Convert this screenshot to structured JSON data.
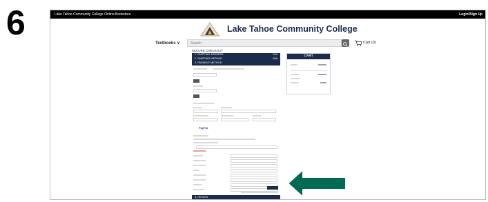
{
  "step_number": "6",
  "topbar": {
    "site_name": "Lake Tahoe Community College Online Bookstore",
    "login": "Login/Sign Up"
  },
  "brand": {
    "name": "Lake Tahoe Community College"
  },
  "nav": {
    "textbooks": "Textbooks ∨"
  },
  "search": {
    "placeholder": "Search"
  },
  "cart": {
    "label": "Cart (0)"
  },
  "checkout": {
    "title": "SECURE CHECKOUT",
    "steps": [
      {
        "label": "1. SHIPPING ADDRESS",
        "edit": "Edit"
      },
      {
        "label": "2. SHIPPING METHOD",
        "edit": "Edit"
      },
      {
        "label": "3. PAYMENT METHOD",
        "edit": ""
      }
    ],
    "paypal": "PayPal",
    "review": "4. REVIEW"
  },
  "cart_summary": {
    "title": "CART"
  },
  "colors": {
    "navy": "#1b2b4b",
    "arrow": "#006b52",
    "black": "#000000"
  }
}
